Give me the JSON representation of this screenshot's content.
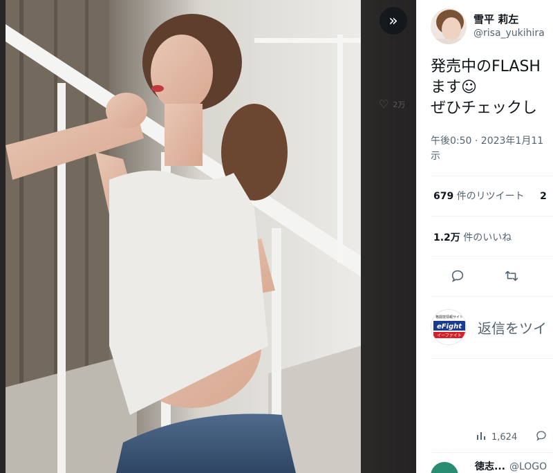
{
  "viewer": {
    "expand_icon": "double-chevron-right",
    "ghost_like_count": "2万"
  },
  "author": {
    "display_name": "雪平 莉左",
    "handle": "@risa_yukihira"
  },
  "tweet": {
    "line1": "発売中のFLASH",
    "line2": "ます☺",
    "line3": "ぜひチェックし",
    "timestamp_line1": "午後0:50 · 2023年1月11",
    "timestamp_line2": "示"
  },
  "stats": {
    "retweets_count": "679",
    "retweets_label": " 件のリツイート",
    "quotes_partial": "2",
    "likes_count": "1.2万",
    "likes_label": " 件のいいね"
  },
  "actions": {
    "reply_icon": "comment-bubble",
    "retweet_icon": "retweet-arrows"
  },
  "reply": {
    "avatar_top_text": "格闘技情報サイト",
    "avatar_brand": "eFight",
    "avatar_sub": "イーファイト",
    "placeholder": "返信をツイ"
  },
  "views": {
    "count": "1,624"
  },
  "next_reply": {
    "name": "徳志...",
    "handle": "@LOGO"
  },
  "colors": {
    "accent_red": "#d4202a",
    "text_primary": "#0f1419",
    "text_secondary": "#536471",
    "next_avatar": "#2a8c73"
  }
}
